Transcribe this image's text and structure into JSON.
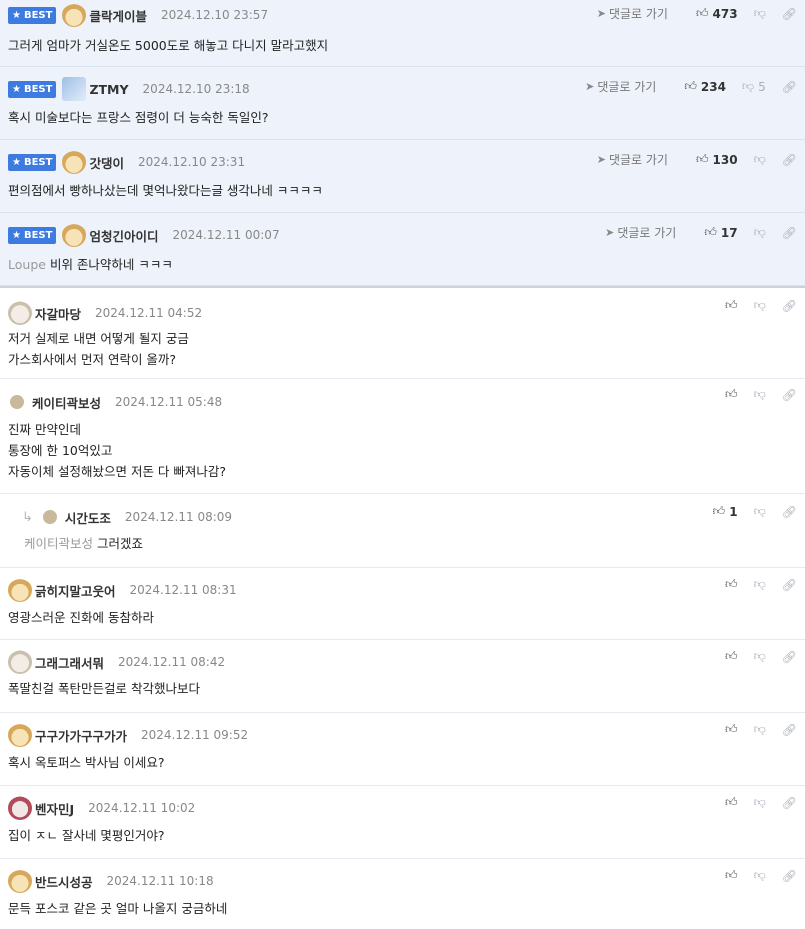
{
  "best_label": "BEST",
  "goto_label": "댓글로 가기",
  "best_comments": [
    {
      "nick": "클락게이블",
      "date": "2024.12.10 23:57",
      "text": "그러게 엄마가 거실온도 5000도로 해놓고 다니지 말라고했지",
      "mention": "",
      "up": "473",
      "down": "",
      "avatar": "fox"
    },
    {
      "nick": "ZTMY",
      "date": "2024.12.10 23:18",
      "text": "혹시 미술보다는 프랑스 점령이 더 능숙한 독일인?",
      "mention": "",
      "up": "234",
      "down": "5",
      "avatar": "bot"
    },
    {
      "nick": "갓댕이",
      "date": "2024.12.10 23:31",
      "text": "편의점에서 빵하나샀는데 몇억나왔다는글 생각나네 ㅋㅋㅋㅋ",
      "mention": "",
      "up": "130",
      "down": "",
      "avatar": "fox"
    },
    {
      "nick": "엄청긴아이디",
      "date": "2024.12.11 00:07",
      "text": "비위 존나약하네 ㅋㅋㅋ",
      "mention": "Loupe",
      "up": "17",
      "down": "",
      "avatar": "fox"
    }
  ],
  "comments": [
    {
      "nick": "자갈마당",
      "date": "2024.12.11 04:52",
      "lines": [
        "저거 실제로 내면 어떻게 될지 궁금",
        "가스회사에서 먼저 연락이 올까?"
      ],
      "up": "",
      "avatar": "dog"
    },
    {
      "nick": "케이티곽보성",
      "date": "2024.12.11 05:48",
      "lines": [
        "진짜 만약인데",
        "통장에 한 10억있고",
        "자동이체 설정해놨으면 저돈 다 빠져나감?"
      ],
      "up": "",
      "avatar": "dot"
    },
    {
      "nick": "시간도조",
      "date": "2024.12.11 08:09",
      "lines": [
        "그러겠죠"
      ],
      "mention": "케이티곽보성",
      "up": "1",
      "avatar": "dot",
      "reply": true
    },
    {
      "nick": "긁히지말고웃어",
      "date": "2024.12.11 08:31",
      "lines": [
        "영광스러운 진화에 동참하라"
      ],
      "up": "",
      "avatar": "fox"
    },
    {
      "nick": "그래그래서뭐",
      "date": "2024.12.11 08:42",
      "lines": [
        "폭딸친걸 폭탄만든걸로 착각했나보다"
      ],
      "up": "",
      "avatar": "dog"
    },
    {
      "nick": "구구가가구구가가",
      "date": "2024.12.11 09:52",
      "lines": [
        "혹시 옥토퍼스 박사님 이세요?"
      ],
      "up": "",
      "avatar": "fox"
    },
    {
      "nick": "벤자민J",
      "date": "2024.12.11 10:02",
      "lines": [
        "집이 ㅈㄴ 잘사네 몇평인거야?"
      ],
      "up": "",
      "avatar": "red"
    },
    {
      "nick": "반드시성공",
      "date": "2024.12.11 10:18",
      "lines": [
        "문득 포스코 같은 곳 얼마 나올지 궁금하네"
      ],
      "up": "",
      "avatar": "fox"
    }
  ]
}
